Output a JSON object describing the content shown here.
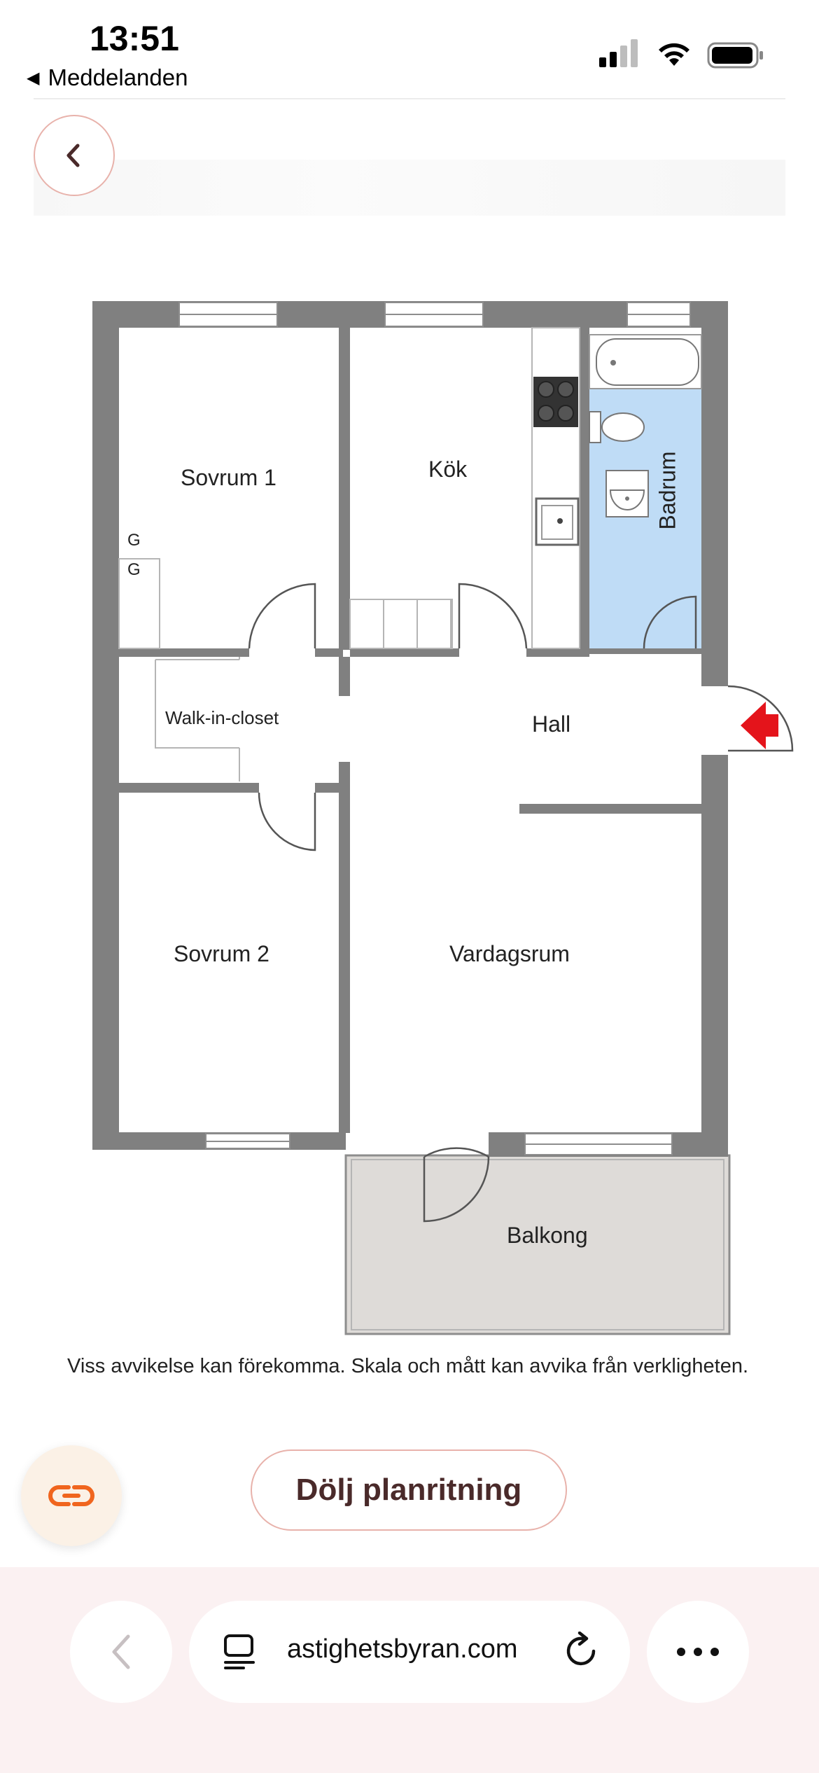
{
  "status_bar": {
    "time": "13:51",
    "back_app": "Meddelanden",
    "back_icon": "back-triangle-icon"
  },
  "floorplan": {
    "rooms": {
      "sovrum1": "Sovrum 1",
      "kok": "Kök",
      "badrum": "Badrum",
      "walk_in_closet": "Walk-in-closet",
      "hall": "Hall",
      "sovrum2": "Sovrum 2",
      "vardagsrum": "Vardagsrum",
      "balkong": "Balkong"
    },
    "wardrobe_marks": [
      "G",
      "G"
    ],
    "disclaimer": "Viss avvikelse kan förekomma. Skala och mått kan avvika från verkligheten.",
    "colors": {
      "wall": "#808080",
      "bathroom": "#bfdcf6",
      "balcony": "#dedbd8",
      "entrance_arrow": "#e4141b"
    }
  },
  "actions": {
    "hide_floorplan_label": "Dölj planritning",
    "link_icon": "link-icon",
    "back_icon": "chevron-left-icon"
  },
  "browser": {
    "url": "astighetsbyran.com",
    "reader_icon": "reader-icon",
    "reload_icon": "reload-icon",
    "more_icon": "more-icon",
    "nav_back_icon": "chevron-left-icon"
  }
}
